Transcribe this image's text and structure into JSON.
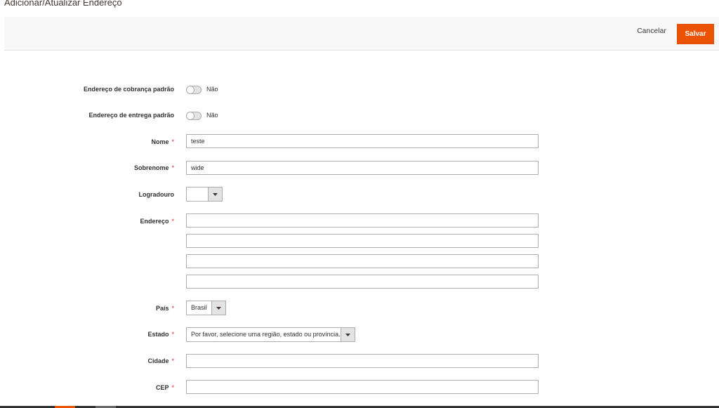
{
  "page": {
    "title": "Adicionar/Atualizar Endereço"
  },
  "actions": {
    "cancel_label": "Cancelar",
    "save_label": "Salvar"
  },
  "form": {
    "default_billing": {
      "label": "Endereço de cobrança padrão",
      "state": "Não"
    },
    "default_shipping": {
      "label": "Endereço de entrega padrão",
      "state": "Não"
    },
    "first_name": {
      "label": "Nome",
      "required_mark": "*",
      "value": "teste"
    },
    "last_name": {
      "label": "Sobrenome",
      "required_mark": "*",
      "value": "wide"
    },
    "street_prefix": {
      "label": "Logradouro",
      "value": ""
    },
    "street": {
      "label": "Endereço",
      "required_mark": "*",
      "lines": [
        "",
        "",
        "",
        ""
      ]
    },
    "country": {
      "label": "País",
      "required_mark": "*",
      "value": "Brasil"
    },
    "region": {
      "label": "Estado",
      "required_mark": "*",
      "value": "Por favor, selecione uma região, estado ou província."
    },
    "city": {
      "label": "Cidade",
      "required_mark": "*",
      "value": ""
    },
    "postcode": {
      "label": "CEP",
      "required_mark": "*",
      "value": ""
    }
  },
  "colors": {
    "accent": "#eb5202",
    "required": "#e22626"
  },
  "icons": {
    "select_arrow": "chevron-down-icon",
    "toggle": "toggle-switch-icon"
  }
}
